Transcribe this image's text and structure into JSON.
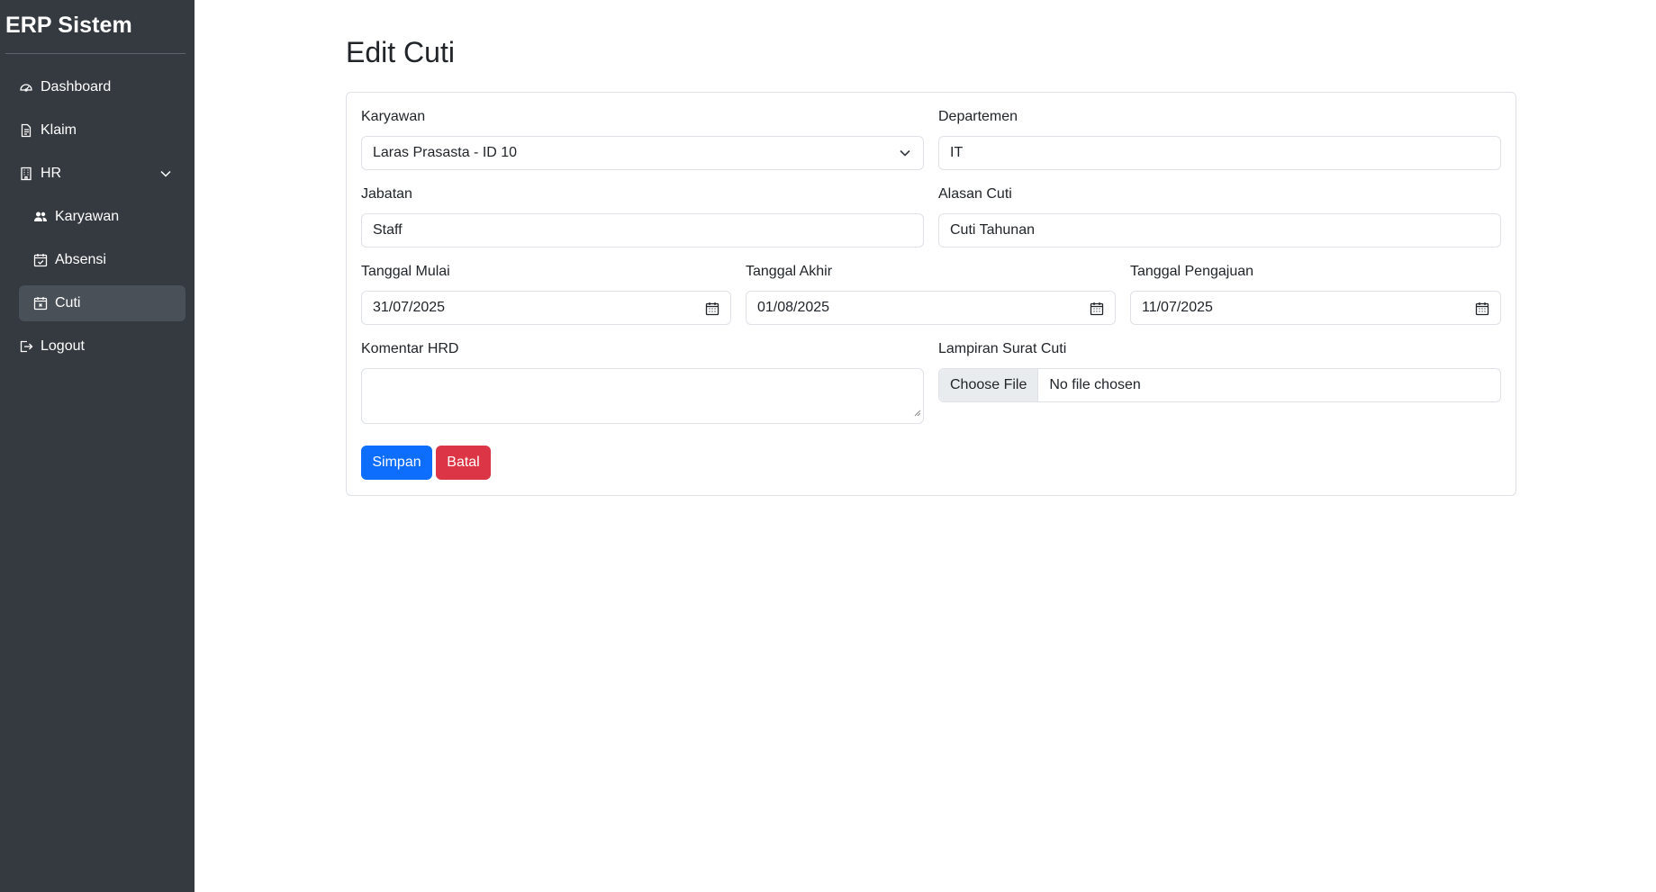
{
  "sidebar": {
    "brand": "ERP Sistem",
    "items": [
      {
        "label": "Dashboard",
        "icon": "speedometer-icon"
      },
      {
        "label": "Klaim",
        "icon": "document-icon"
      },
      {
        "label": "HR",
        "icon": "building-icon"
      },
      {
        "label": "Karyawan",
        "icon": "people-icon"
      },
      {
        "label": "Absensi",
        "icon": "calendar-check-icon"
      },
      {
        "label": "Cuti",
        "icon": "calendar-x-icon"
      },
      {
        "label": "Logout",
        "icon": "logout-icon"
      }
    ],
    "active_item": "Cuti"
  },
  "page": {
    "title": "Edit Cuti"
  },
  "form": {
    "karyawan": {
      "label": "Karyawan",
      "value": "Laras Prasasta - ID 10"
    },
    "departemen": {
      "label": "Departemen",
      "value": "IT"
    },
    "jabatan": {
      "label": "Jabatan",
      "value": "Staff"
    },
    "alasan": {
      "label": "Alasan Cuti",
      "value": "Cuti Tahunan"
    },
    "tanggal_mulai": {
      "label": "Tanggal Mulai",
      "value": "31/07/2025"
    },
    "tanggal_akhir": {
      "label": "Tanggal Akhir",
      "value": "01/08/2025"
    },
    "tanggal_pengajuan": {
      "label": "Tanggal Pengajuan",
      "value": "11/07/2025"
    },
    "komentar": {
      "label": "Komentar HRD",
      "value": ""
    },
    "lampiran": {
      "label": "Lampiran Surat Cuti",
      "button": "Choose File",
      "status": "No file chosen"
    },
    "save_label": "Simpan",
    "cancel_label": "Batal"
  },
  "colors": {
    "sidebar_bg": "#343a40",
    "active_item_bg": "#495057",
    "primary": "#0d6efd",
    "danger": "#dc3545"
  }
}
